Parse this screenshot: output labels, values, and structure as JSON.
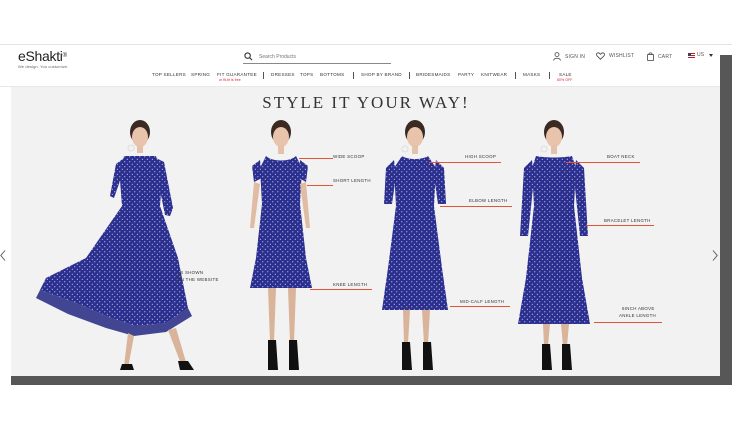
{
  "header": {
    "logo_text": "eShakti",
    "logo_reg": "®",
    "tagline": "We design. You customize.",
    "search_placeholder": "Search Products",
    "signin_label": "SIGN IN",
    "wishlist_label": "WISHLIST",
    "cart_label": "CART",
    "region_label": "US"
  },
  "nav": {
    "items": [
      "TOP SELLERS",
      "SPRING",
      "FIT GUARANTEE",
      "DRESSES",
      "TOPS",
      "BOTTOMS",
      "SHOP BY BRAND",
      "BRIDESMAIDS",
      "PARTY",
      "KNITWEAR",
      "MASKS",
      "SALE"
    ],
    "fit_sub": "or fit-fit is free",
    "sale_sub": "60% OFF"
  },
  "banner": {
    "title": "STYLE IT YOUR WAY!",
    "as_shown_line1": "AS SHOWN",
    "as_shown_line2": "ON THE WEBSITE",
    "labels": {
      "wide_scoop": "WIDE SCOOP",
      "short_length": "SHORT LENGTH",
      "knee_length": "KNEE LENGTH",
      "high_scoop": "HIGH SCOOP",
      "elbow_length": "ELBOW LENGTH",
      "mid_calf_length": "MID-CALF LENGTH",
      "boat_neck": "BOAT NECK",
      "bracelet_length": "BRACELET LENGTH",
      "ankle_line1": "6INCH ABOVE",
      "ankle_line2": "ANKLE LENGTH"
    }
  },
  "colors": {
    "dress": "#2b2f8f",
    "dress_dark": "#1f2270",
    "accent_line": "#e2553a",
    "banner_bg": "#f2f2f2",
    "sale_red": "#d22233"
  }
}
